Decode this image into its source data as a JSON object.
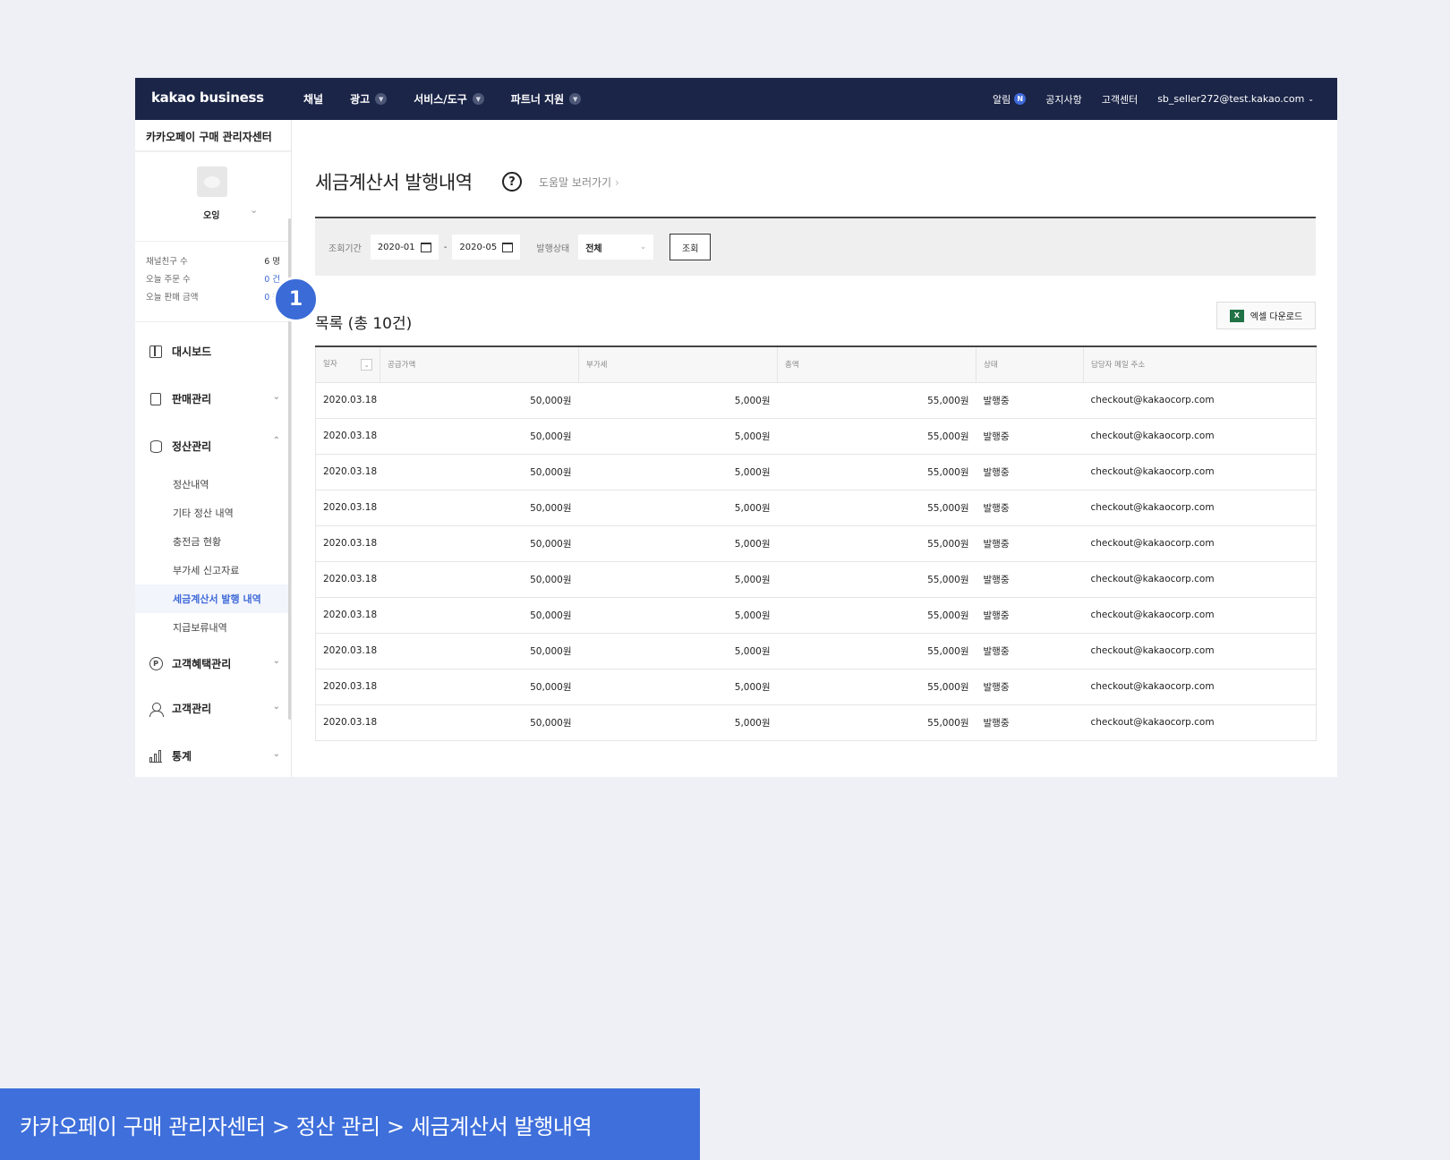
{
  "topbar": {
    "logo": "kakao business",
    "nav": [
      {
        "label": "채널",
        "has_menu": false
      },
      {
        "label": "광고",
        "has_menu": true
      },
      {
        "label": "서비스/도구",
        "has_menu": true
      },
      {
        "label": "파트너 지원",
        "has_menu": true
      }
    ],
    "alert_label": "알림",
    "alert_badge": "N",
    "notice_label": "공지사항",
    "support_label": "고객센터",
    "account": "sb_seller272@test.kakao.com"
  },
  "sidebar": {
    "title": "카카오페이 구매 관리자센터",
    "profile_name": "오잉",
    "stats": [
      {
        "label": "채널친구 수",
        "value": "6 명"
      },
      {
        "label": "오늘 주문 수",
        "value": "0 건"
      },
      {
        "label": "오늘 판매 금액",
        "value": "0 원"
      }
    ],
    "menu": {
      "dashboard": "대시보드",
      "sales": "판매관리",
      "settlement": "정산관리",
      "sub": [
        "정산내역",
        "기타 정산 내역",
        "충전금 현황",
        "부가세 신고자료",
        "세금계산서 발행 내역",
        "지급보류내역"
      ],
      "benefit": "고객혜택관리",
      "customer": "고객관리",
      "stats": "통계"
    }
  },
  "main": {
    "title": "세금계산서 발행내역",
    "help_link": "도움말 보러가기",
    "filter": {
      "period_label": "조회기간",
      "date_from": "2020-01",
      "date_to": "2020-05",
      "status_label": "발행상태",
      "status_value": "전체",
      "search_button": "조회"
    },
    "list_title": "목록 (총 10건)",
    "excel_button": "엑셀 다운로드",
    "columns": [
      "일자",
      "공급가액",
      "부가세",
      "총액",
      "상태",
      "담당자 메일 주소"
    ],
    "rows": [
      [
        "2020.03.18",
        "50,000원",
        "5,000원",
        "55,000원",
        "발행중",
        "checkout@kakaocorp.com"
      ],
      [
        "2020.03.18",
        "50,000원",
        "5,000원",
        "55,000원",
        "발행중",
        "checkout@kakaocorp.com"
      ],
      [
        "2020.03.18",
        "50,000원",
        "5,000원",
        "55,000원",
        "발행중",
        "checkout@kakaocorp.com"
      ],
      [
        "2020.03.18",
        "50,000원",
        "5,000원",
        "55,000원",
        "발행중",
        "checkout@kakaocorp.com"
      ],
      [
        "2020.03.18",
        "50,000원",
        "5,000원",
        "55,000원",
        "발행중",
        "checkout@kakaocorp.com"
      ],
      [
        "2020.03.18",
        "50,000원",
        "5,000원",
        "55,000원",
        "발행중",
        "checkout@kakaocorp.com"
      ],
      [
        "2020.03.18",
        "50,000원",
        "5,000원",
        "55,000원",
        "발행중",
        "checkout@kakaocorp.com"
      ],
      [
        "2020.03.18",
        "50,000원",
        "5,000원",
        "55,000원",
        "발행중",
        "checkout@kakaocorp.com"
      ],
      [
        "2020.03.18",
        "50,000원",
        "5,000원",
        "55,000원",
        "발행중",
        "checkout@kakaocorp.com"
      ],
      [
        "2020.03.18",
        "50,000원",
        "5,000원",
        "55,000원",
        "발행중",
        "checkout@kakaocorp.com"
      ]
    ]
  },
  "marker_number": "1",
  "caption": "카카오페이 구매 관리자센터 > 정산 관리 > 세금계산서 발행내역",
  "colors": {
    "topbar": "#1b2548",
    "accent": "#3f6ad8",
    "caption_bg": "#3e6fdb",
    "page_bg": "#eef0f5"
  }
}
